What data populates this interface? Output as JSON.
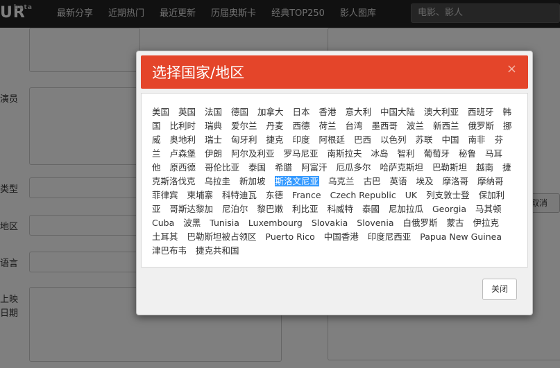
{
  "header": {
    "logo": "UR",
    "logo_badge": "beta",
    "nav": [
      "最新分享",
      "近期热门",
      "最近更新",
      "历届奥斯卡",
      "经典TOP250",
      "影人图库"
    ],
    "search_placeholder": "电影、影人"
  },
  "form": {
    "labels": [
      "演员",
      "类型",
      "地区",
      "语言",
      "上映",
      "日期"
    ],
    "cancel_label": "取消"
  },
  "modal": {
    "title": "选择国家/地区",
    "close_symbol": "×",
    "close_button": "关闭",
    "selected": "斯洛文尼亚",
    "countries": [
      "美国",
      "英国",
      "法国",
      "德国",
      "加拿大",
      "日本",
      "香港",
      "意大利",
      "中国大陆",
      "澳大利亚",
      "西班牙",
      "韩国",
      "比利时",
      "瑞典",
      "爱尔兰",
      "丹麦",
      "西德",
      "荷兰",
      "台湾",
      "墨西哥",
      "波兰",
      "新西兰",
      "俄罗斯",
      "挪威",
      "奥地利",
      "瑞士",
      "匈牙利",
      "捷克",
      "印度",
      "阿根廷",
      "巴西",
      "以色列",
      "苏联",
      "中国",
      "南非",
      "芬兰",
      "卢森堡",
      "伊朗",
      "阿尔及利亚",
      "罗马尼亚",
      "南斯拉夫",
      "冰岛",
      "智利",
      "葡萄牙",
      "秘鲁",
      "马耳他",
      "原西德",
      "哥伦比亚",
      "泰国",
      "希腊",
      "阿富汗",
      "厄瓜多尔",
      "哈萨克斯坦",
      "巴勒斯坦",
      "越南",
      "捷克斯洛伐克",
      "乌拉圭",
      "新加坡",
      "斯洛文尼亚",
      "乌克兰",
      "古巴",
      "英语",
      "埃及",
      "摩洛哥",
      "摩纳哥",
      "菲律宾",
      "柬埔寨",
      "科特迪瓦",
      "东德",
      "France",
      "Czech Republic",
      "UK",
      "列支敦士登",
      "保加利亚",
      "哥斯达黎加",
      "尼泊尔",
      "黎巴嫩",
      "利比亚",
      "科威特",
      "泰國",
      "尼加拉瓜",
      "Georgia",
      "马其顿",
      "Cuba",
      "波黑",
      "Tunisia",
      "Luxembourg",
      "Slovakia",
      "Slovenia",
      "白俄罗斯",
      "蒙古",
      "伊拉克",
      "土耳其",
      "巴勒斯坦被占领区",
      "Puerto Rico",
      "中国香港",
      "印度尼西亚",
      "Papua New Guinea",
      "津巴布韦",
      "捷克共和国"
    ]
  },
  "colors": {
    "header_bar": "#222222",
    "modal_header": "#e4452a",
    "selection": "#3399ff"
  }
}
